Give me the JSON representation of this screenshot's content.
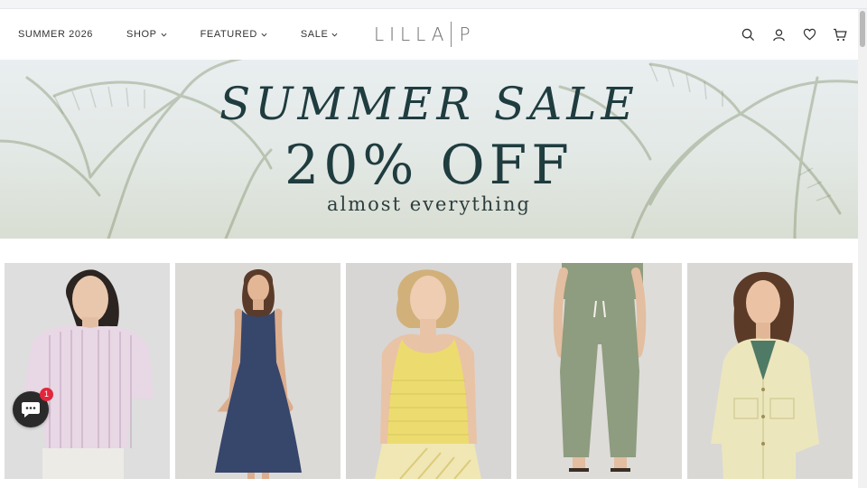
{
  "header": {
    "nav": [
      {
        "label": "SUMMER 2026",
        "has_dropdown": false
      },
      {
        "label": "SHOP",
        "has_dropdown": true
      },
      {
        "label": "FEATURED",
        "has_dropdown": true
      },
      {
        "label": "SALE",
        "has_dropdown": true
      }
    ],
    "logo": {
      "left": "LILLA",
      "right": "P"
    },
    "icons": [
      "search-icon",
      "account-icon",
      "wishlist-heart-icon",
      "cart-icon"
    ]
  },
  "hero": {
    "title": "SUMMER SALE",
    "offer": "20% OFF",
    "subtitle": "almost everything"
  },
  "products": [
    {
      "name": "striped-short-sleeve-shirt",
      "color": "#e8d7e4"
    },
    {
      "name": "navy-midi-dress",
      "color": "#37466b"
    },
    {
      "name": "yellow-knit-tank",
      "color": "#ecdc6f"
    },
    {
      "name": "sage-drawstring-pants",
      "color": "#8e9c7f"
    },
    {
      "name": "butter-yellow-jacket",
      "color": "#ece6bd"
    }
  ],
  "chat": {
    "badge_count": "1"
  },
  "colors": {
    "accent": "#1f3c3f",
    "badge": "#e3263b"
  }
}
